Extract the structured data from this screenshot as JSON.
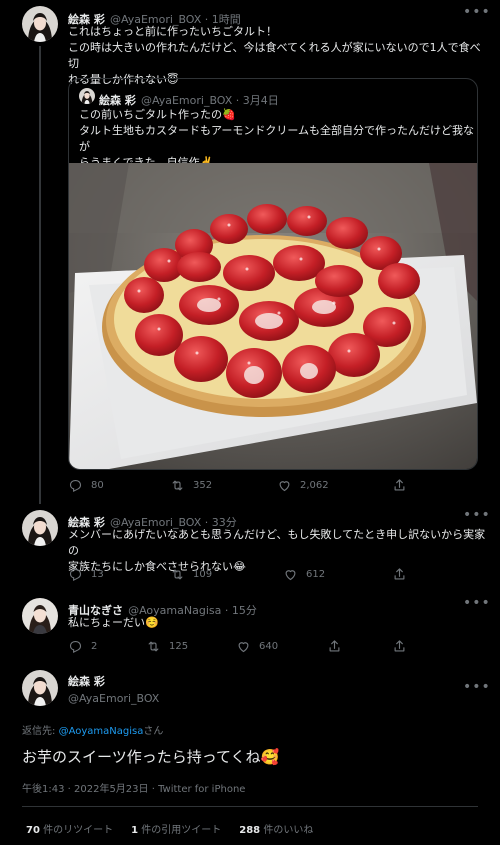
{
  "colors": {
    "accent": "#1d9bf0",
    "muted": "#71767b",
    "text": "#e7e9ea",
    "border": "#2f3336"
  },
  "tweet1": {
    "name": "絵森 彩",
    "handle": "@AyaEmori_BOX · 1時間",
    "line1": "これはちょっと前に作ったいちごタルト！",
    "line2": "この時は大きいの作れたんだけど、今は食べてくれる人が家にいないので1人で食べ切",
    "line3": "れる量しか作れない😇",
    "quote": {
      "name": "絵森 彩",
      "handle": "@AyaEmori_BOX · 3月4日",
      "line1": "この前いちごタルト作ったの🍓",
      "line2": "タルト生地もカスタードもアーモンドクリームも全部自分で作ったんだけど我なが",
      "line3": "らうまくできた、自信作✌️"
    },
    "replies": "80",
    "retweets": "352",
    "likes": "2,062"
  },
  "tweet2": {
    "name": "絵森 彩",
    "handle": "@AyaEmori_BOX · 33分",
    "line1": "メンバーにあげたいなあとも思うんだけど、もし失敗してたとき申し訳ないから実家の",
    "line2": "家族たちにしか食べさせられない😂",
    "replies": "13",
    "retweets": "109",
    "likes": "612"
  },
  "tweet3": {
    "name": "青山なぎさ",
    "handle": "@AoyamaNagisa · 15分",
    "line1": "私にちょーだい☺️",
    "replies": "2",
    "retweets": "125",
    "likes": "640"
  },
  "main": {
    "name": "絵森 彩",
    "handle": "@AyaEmori_BOX",
    "reply_to_prefix": "返信先: ",
    "reply_to_handle": "@AoyamaNagisa",
    "reply_to_suffix": "さん",
    "text": "お芋のスイーツ作ったら持ってくね🥰",
    "meta": "午後1:43 · 2022年5月23日 · Twitter for iPhone",
    "stats": {
      "retweets_count": "70",
      "retweets_label": " 件のリツイート",
      "quotes_count": "1",
      "quotes_label": " 件の引用ツイート",
      "likes_count": "288",
      "likes_label": " 件のいいね"
    }
  }
}
